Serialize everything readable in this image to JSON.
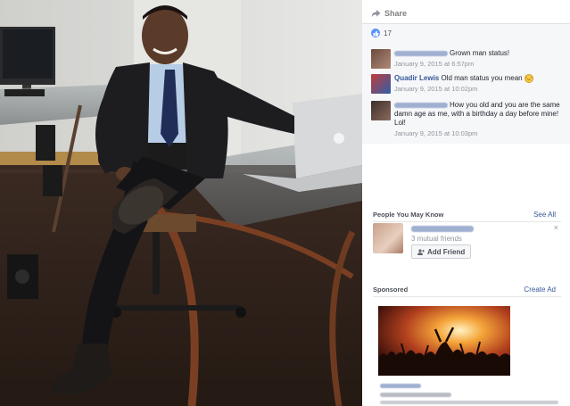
{
  "post": {
    "share_label": "Share",
    "like_count": "17"
  },
  "comments": [
    {
      "name": "",
      "text": "Grown man status!",
      "time": "January 9, 2015 at 6:57pm"
    },
    {
      "name": "Quadir Lewis",
      "text": "Old man status you mean",
      "time": "January 9, 2015 at 10:02pm"
    },
    {
      "name": "",
      "text": "How you old and you are the same damn age as me, with a birthday a day before mine! Lol!",
      "time": "January 9, 2015 at 10:03pm"
    }
  ],
  "people_you_may_know": {
    "title": "People You May Know",
    "see_all": "See All",
    "mutual": "3 mutual friends",
    "add_friend": "Add Friend",
    "close": "×"
  },
  "sponsored": {
    "title": "Sponsored",
    "create_ad": "Create Ad"
  },
  "colors": {
    "link": "#365899",
    "like_blue": "#5890ff",
    "panel_bg": "#f6f7f9"
  }
}
